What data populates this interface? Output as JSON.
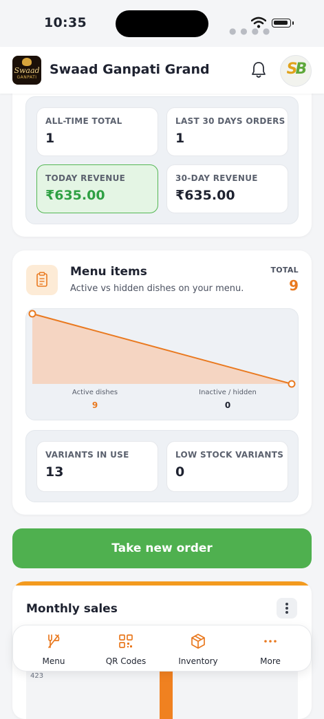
{
  "status_bar": {
    "time": "10:35"
  },
  "app": {
    "title": "Swaad Ganpati Grand",
    "logo_text_1": "Swaad",
    "logo_text_2": "GANPATI"
  },
  "summary": {
    "stats": [
      {
        "label": "ALL-TIME TOTAL",
        "value": "1"
      },
      {
        "label": "LAST 30 DAYS ORDERS",
        "value": "1"
      },
      {
        "label": "TODAY REVENUE",
        "value": "₹635.00"
      },
      {
        "label": "30-DAY REVENUE",
        "value": "₹635.00"
      }
    ]
  },
  "menu_items": {
    "title": "Menu items",
    "subtitle": "Active vs hidden dishes on your menu.",
    "total_label": "TOTAL",
    "total_value": "9",
    "icon": "clipboard-icon"
  },
  "chart_data": {
    "type": "area",
    "categories": [
      "Active dishes",
      "Inactive / hidden"
    ],
    "values": [
      9,
      0
    ],
    "value_labels": [
      "9",
      "0"
    ],
    "colors": {
      "line": "#e9791f",
      "fill": "#f5d5c2"
    }
  },
  "variants": {
    "stats": [
      {
        "label": "VARIANTS IN USE",
        "value": "13"
      },
      {
        "label": "LOW STOCK VARIANTS",
        "value": "0"
      }
    ]
  },
  "cta": {
    "label": "Take new order",
    "color": "#4fb04f"
  },
  "monthly_sales": {
    "title": "Monthly sales",
    "ytick_top": "423",
    "accent": "#f08120"
  },
  "bottom_nav": {
    "items": [
      {
        "label": "Menu",
        "icon": "fork-knife-icon"
      },
      {
        "label": "QR Codes",
        "icon": "qr-code-icon"
      },
      {
        "label": "Inventory",
        "icon": "box-icon"
      },
      {
        "label": "More",
        "icon": "more-dots-icon"
      }
    ]
  },
  "colors": {
    "accent_orange": "#e9791f",
    "green": "#2ea043",
    "background": "#f4f5f7"
  }
}
